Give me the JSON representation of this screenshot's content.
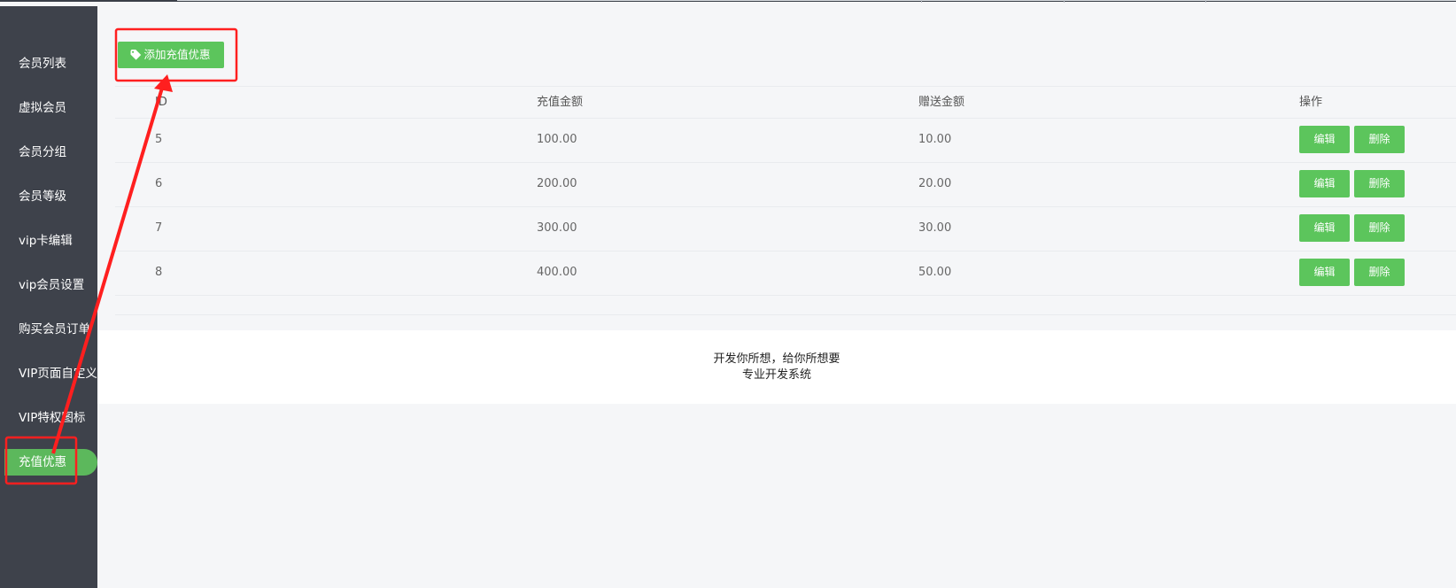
{
  "sidebar": {
    "items": [
      {
        "label": "会员列表"
      },
      {
        "label": "虚拟会员"
      },
      {
        "label": "会员分组"
      },
      {
        "label": "会员等级"
      },
      {
        "label": "vip卡编辑"
      },
      {
        "label": "vip会员设置"
      },
      {
        "label": "购买会员订单"
      },
      {
        "label": "VIP页面自定义"
      },
      {
        "label": "VIP特权图标"
      },
      {
        "label": "充值优惠"
      }
    ],
    "active_index": 9
  },
  "toolbar": {
    "add_button_label": "添加充值优惠",
    "add_button_icon": "tag-icon"
  },
  "table": {
    "headers": {
      "id": "ID",
      "amount": "充值金额",
      "bonus": "赠送金额",
      "actions": "操作"
    },
    "rows": [
      {
        "id": "5",
        "amount": "100.00",
        "bonus": "10.00",
        "edit": "编辑",
        "delete": "删除"
      },
      {
        "id": "6",
        "amount": "200.00",
        "bonus": "20.00",
        "edit": "编辑",
        "delete": "删除"
      },
      {
        "id": "7",
        "amount": "300.00",
        "bonus": "30.00",
        "edit": "编辑",
        "delete": "删除"
      },
      {
        "id": "8",
        "amount": "400.00",
        "bonus": "50.00",
        "edit": "编辑",
        "delete": "删除"
      }
    ]
  },
  "footer": {
    "line1": "开发你所想，给你所想要",
    "line2": "专业开发系统"
  },
  "colors": {
    "sidebar_bg": "#3e424b",
    "accent_green": "#5cc55c",
    "annotation_red": "#ff1f1f",
    "page_bg": "#f5f6f8"
  }
}
